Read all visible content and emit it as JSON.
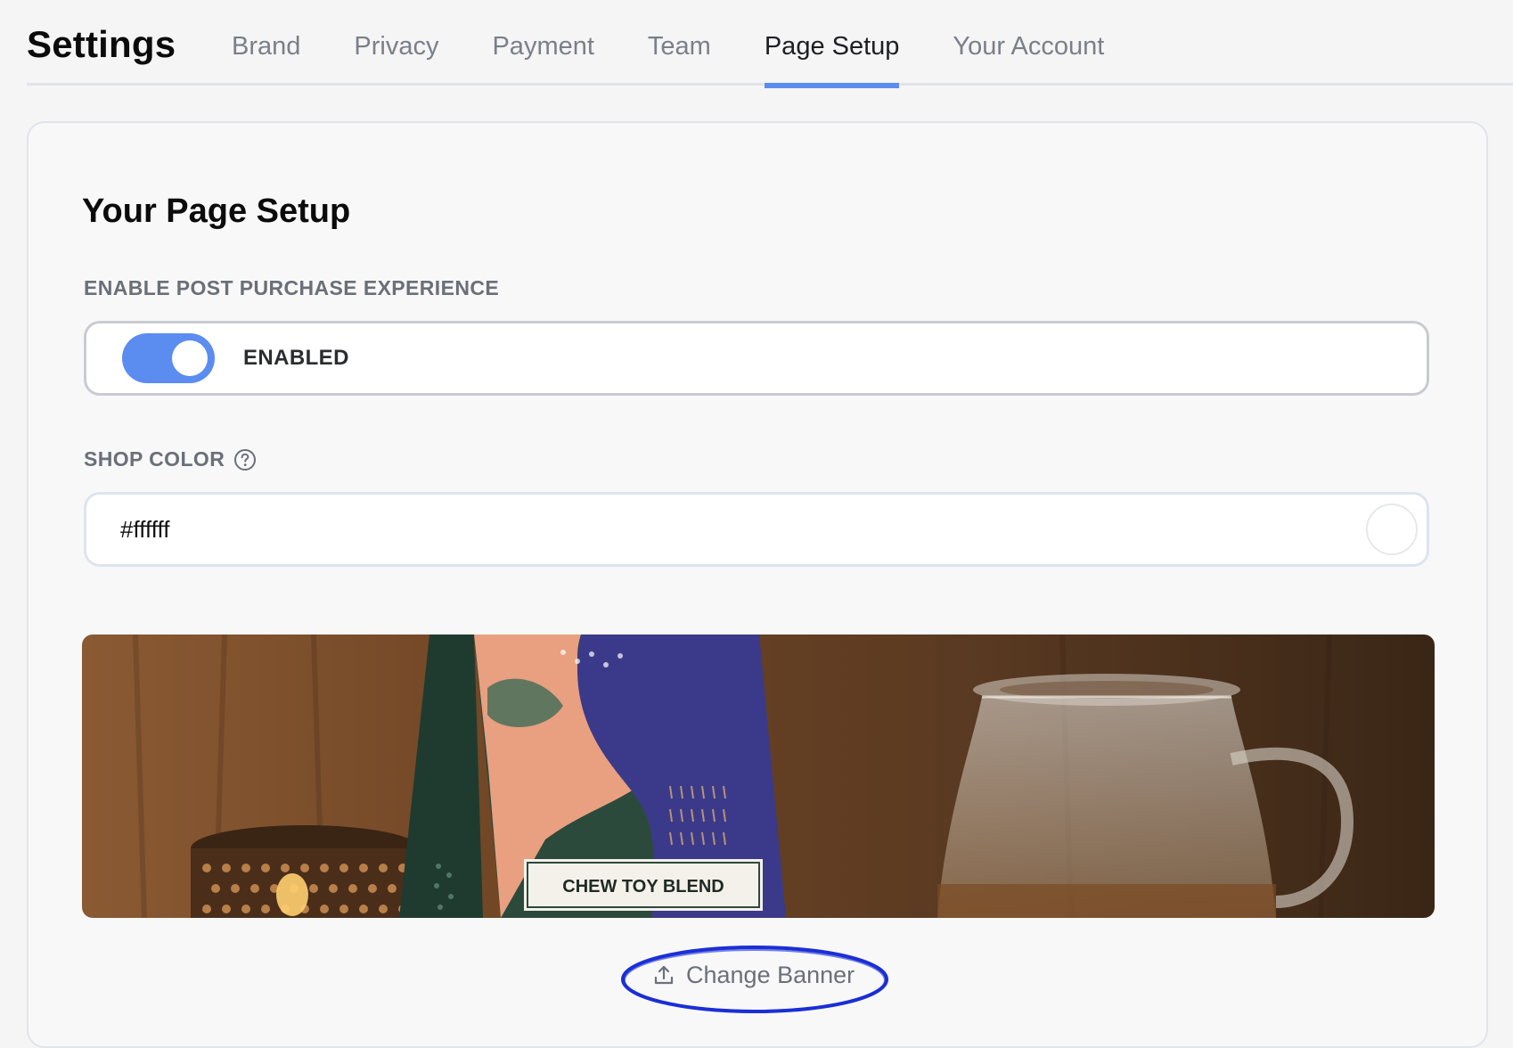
{
  "header": {
    "title": "Settings",
    "tabs": [
      {
        "label": "Brand",
        "active": false
      },
      {
        "label": "Privacy",
        "active": false
      },
      {
        "label": "Payment",
        "active": false
      },
      {
        "label": "Team",
        "active": false
      },
      {
        "label": "Page Setup",
        "active": true
      },
      {
        "label": "Your Account",
        "active": false
      }
    ]
  },
  "card": {
    "title": "Your Page Setup",
    "post_purchase": {
      "label": "ENABLE POST PURCHASE EXPERIENCE",
      "toggle_text": "ENABLED",
      "enabled": true
    },
    "shop_color": {
      "label": "SHOP COLOR",
      "value": "#ffffff",
      "help_icon": "question-circle-icon"
    },
    "banner": {
      "package_label": "CHEW TOY BLEND"
    },
    "change_banner_label": "Change Banner",
    "change_banner_icon": "upload-icon"
  },
  "colors": {
    "accent": "#5b8cf0",
    "annotation": "#1a2fd6"
  }
}
